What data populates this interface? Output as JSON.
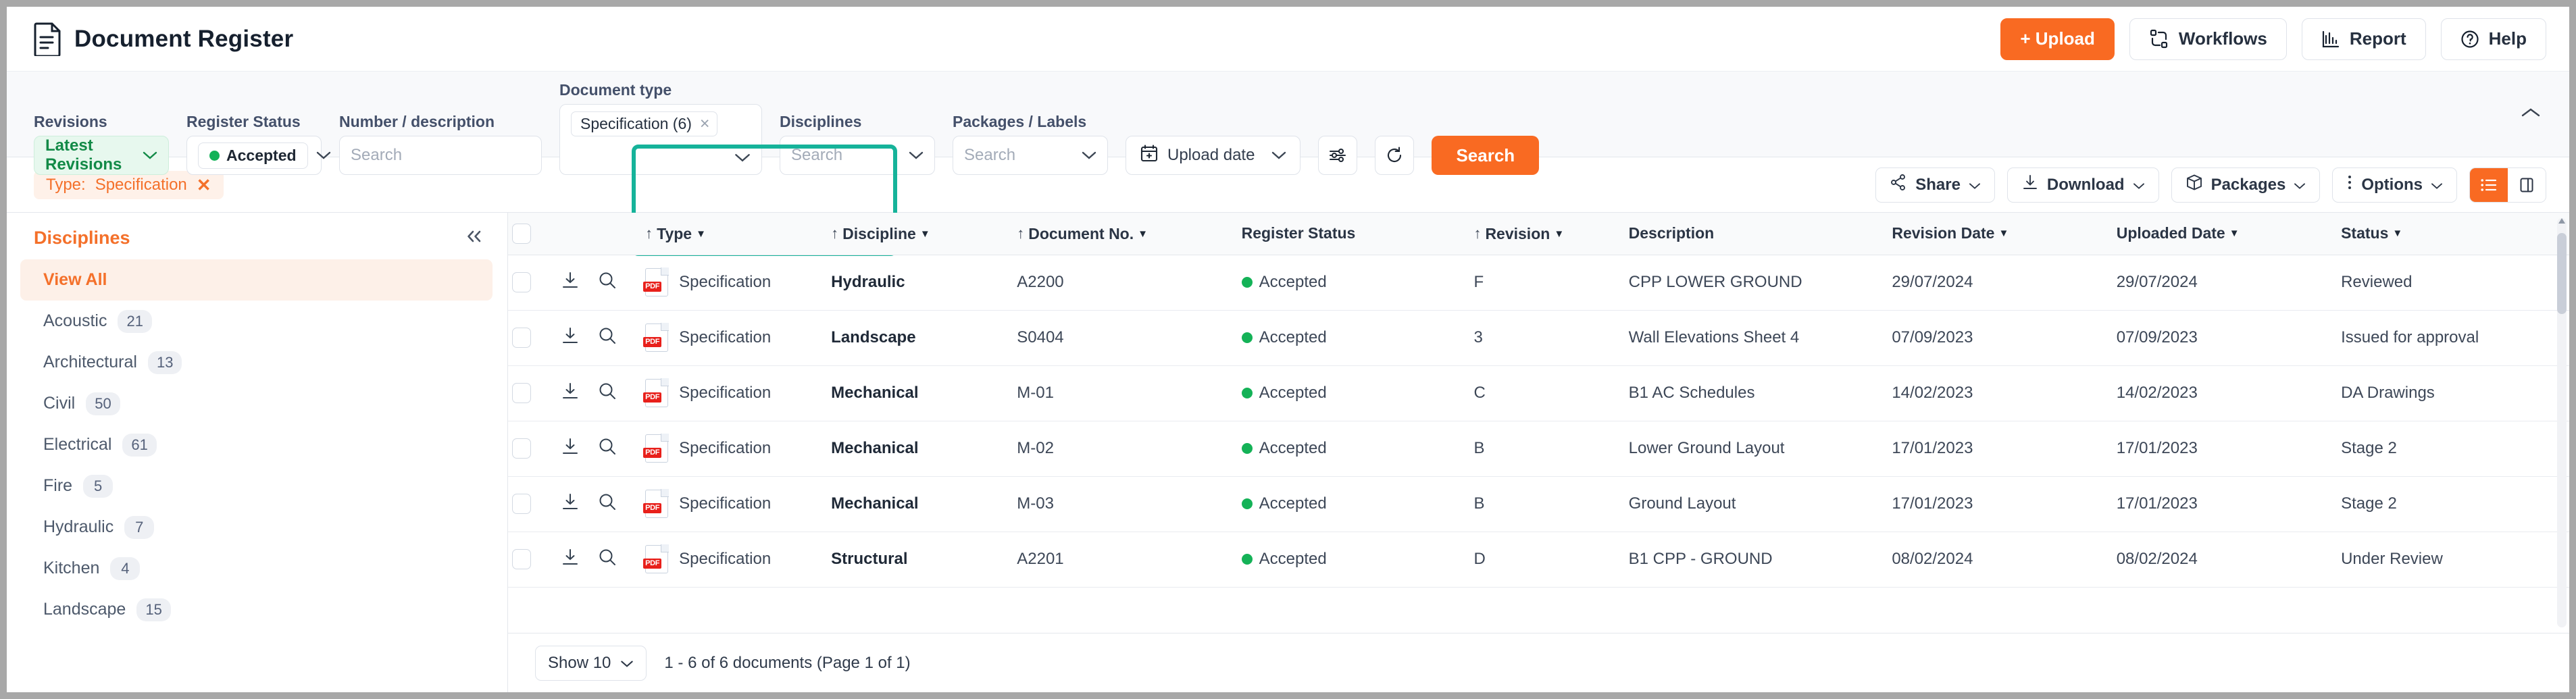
{
  "header": {
    "title": "Document Register",
    "doc_icon": "document-icon",
    "actions": [
      {
        "label": "+ Upload",
        "icon": "plus-icon",
        "primary": true
      },
      {
        "label": "Workflows",
        "icon": "workflows-icon",
        "primary": false
      },
      {
        "label": "Report",
        "icon": "report-bars-icon",
        "primary": false
      },
      {
        "label": "Help",
        "icon": "question-circle-icon",
        "primary": false
      }
    ]
  },
  "filters": {
    "revisions": {
      "label": "Revisions",
      "value": "Latest Revisions"
    },
    "register_status": {
      "label": "Register Status",
      "value": "Accepted",
      "dot_color": "#12b257"
    },
    "number_description": {
      "label": "Number / description",
      "placeholder": "Search",
      "value": ""
    },
    "document_type": {
      "label": "Document type",
      "tags": [
        {
          "text": "Specification (6)",
          "remove": "×"
        }
      ],
      "highlighted": true,
      "highlight_color": "#16b39a"
    },
    "disciplines": {
      "label": "Disciplines",
      "placeholder": "Search",
      "value": ""
    },
    "packages_labels": {
      "label": "Packages / Labels",
      "placeholder": "Search",
      "value": ""
    },
    "upload_date": {
      "label": "Upload date",
      "icon": "calendar-plus-icon"
    },
    "settings_icon": "sliders-icon",
    "reset_icon": "refresh-icon",
    "search_button": "Search",
    "collapse_icon": "chevron-up-icon"
  },
  "chiprow": {
    "chips": [
      {
        "prefix": "Type:",
        "value": "Specification",
        "remove": "✕"
      }
    ],
    "actions": [
      {
        "label": "Share",
        "icon": "share-icon"
      },
      {
        "label": "Download",
        "icon": "download-icon"
      },
      {
        "label": "Packages",
        "icon": "box-icon"
      },
      {
        "label": "Options",
        "icon": "kebab-icon"
      }
    ],
    "view_toggle": [
      {
        "icon": "list-view-icon",
        "active": true
      },
      {
        "icon": "split-view-icon",
        "active": false
      }
    ]
  },
  "sidebar": {
    "title": "Disciplines",
    "collapse_icon": "chevrons-left-icon",
    "items": [
      {
        "label": "View All",
        "count": "",
        "active": true
      },
      {
        "label": "Acoustic",
        "count": "21",
        "active": false
      },
      {
        "label": "Architectural",
        "count": "13",
        "active": false
      },
      {
        "label": "Civil",
        "count": "50",
        "active": false
      },
      {
        "label": "Electrical",
        "count": "61",
        "active": false
      },
      {
        "label": "Fire",
        "count": "5",
        "active": false
      },
      {
        "label": "Hydraulic",
        "count": "7",
        "active": false
      },
      {
        "label": "Kitchen",
        "count": "4",
        "active": false
      },
      {
        "label": "Landscape",
        "count": "15",
        "active": false
      }
    ]
  },
  "table": {
    "columns": [
      {
        "key": "type",
        "label": "Type",
        "sortable": true,
        "sorted_asc": true
      },
      {
        "key": "discipline",
        "label": "Discipline",
        "sortable": true,
        "sorted_asc": true
      },
      {
        "key": "document_no",
        "label": "Document No.",
        "sortable": true,
        "sorted_asc": true
      },
      {
        "key": "register_status",
        "label": "Register Status",
        "sortable": false
      },
      {
        "key": "revision",
        "label": "Revision",
        "sortable": true,
        "sorted_asc": true
      },
      {
        "key": "description",
        "label": "Description",
        "sortable": false
      },
      {
        "key": "revision_date",
        "label": "Revision Date",
        "sortable": true
      },
      {
        "key": "uploaded_date",
        "label": "Uploaded Date",
        "sortable": true
      },
      {
        "key": "status",
        "label": "Status",
        "sortable": true
      }
    ],
    "rows": [
      {
        "file_icon": "pdf-file-icon",
        "type": "Specification",
        "discipline": "Hydraulic",
        "document_no": "A2200",
        "register_status": "Accepted",
        "revision": "F",
        "description": "CPP LOWER GROUND",
        "revision_date": "29/07/2024",
        "uploaded_date": "29/07/2024",
        "status": "Reviewed"
      },
      {
        "file_icon": "pdf-file-icon",
        "type": "Specification",
        "discipline": "Landscape",
        "document_no": "S0404",
        "register_status": "Accepted",
        "revision": "3",
        "description": "Wall Elevations Sheet 4",
        "revision_date": "07/09/2023",
        "uploaded_date": "07/09/2023",
        "status": "Issued for approval"
      },
      {
        "file_icon": "pdf-file-icon",
        "type": "Specification",
        "discipline": "Mechanical",
        "document_no": "M-01",
        "register_status": "Accepted",
        "revision": "C",
        "description": "B1 AC Schedules",
        "revision_date": "14/02/2023",
        "uploaded_date": "14/02/2023",
        "status": "DA Drawings"
      },
      {
        "file_icon": "pdf-file-icon",
        "type": "Specification",
        "discipline": "Mechanical",
        "document_no": "M-02",
        "register_status": "Accepted",
        "revision": "B",
        "description": "Lower Ground Layout",
        "revision_date": "17/01/2023",
        "uploaded_date": "17/01/2023",
        "status": "Stage 2"
      },
      {
        "file_icon": "pdf-file-icon",
        "type": "Specification",
        "discipline": "Mechanical",
        "document_no": "M-03",
        "register_status": "Accepted",
        "revision": "B",
        "description": "Ground Layout",
        "revision_date": "17/01/2023",
        "uploaded_date": "17/01/2023",
        "status": "Stage 2"
      },
      {
        "file_icon": "pdf-file-icon",
        "type": "Specification",
        "discipline": "Structural",
        "document_no": "A2201",
        "register_status": "Accepted",
        "revision": "D",
        "description": "B1 CPP - GROUND",
        "revision_date": "08/02/2024",
        "uploaded_date": "08/02/2024",
        "status": "Under Review"
      }
    ],
    "row_actions": [
      "download-icon",
      "preview-search-icon"
    ]
  },
  "footer": {
    "show_label": "Show 10",
    "page_info": "1 - 6 of 6 documents (Page 1 of 1)"
  },
  "colors": {
    "accent": "#f96a22",
    "highlight": "#16b39a",
    "green": "#12b257",
    "chip_bg": "#fef1e9"
  }
}
